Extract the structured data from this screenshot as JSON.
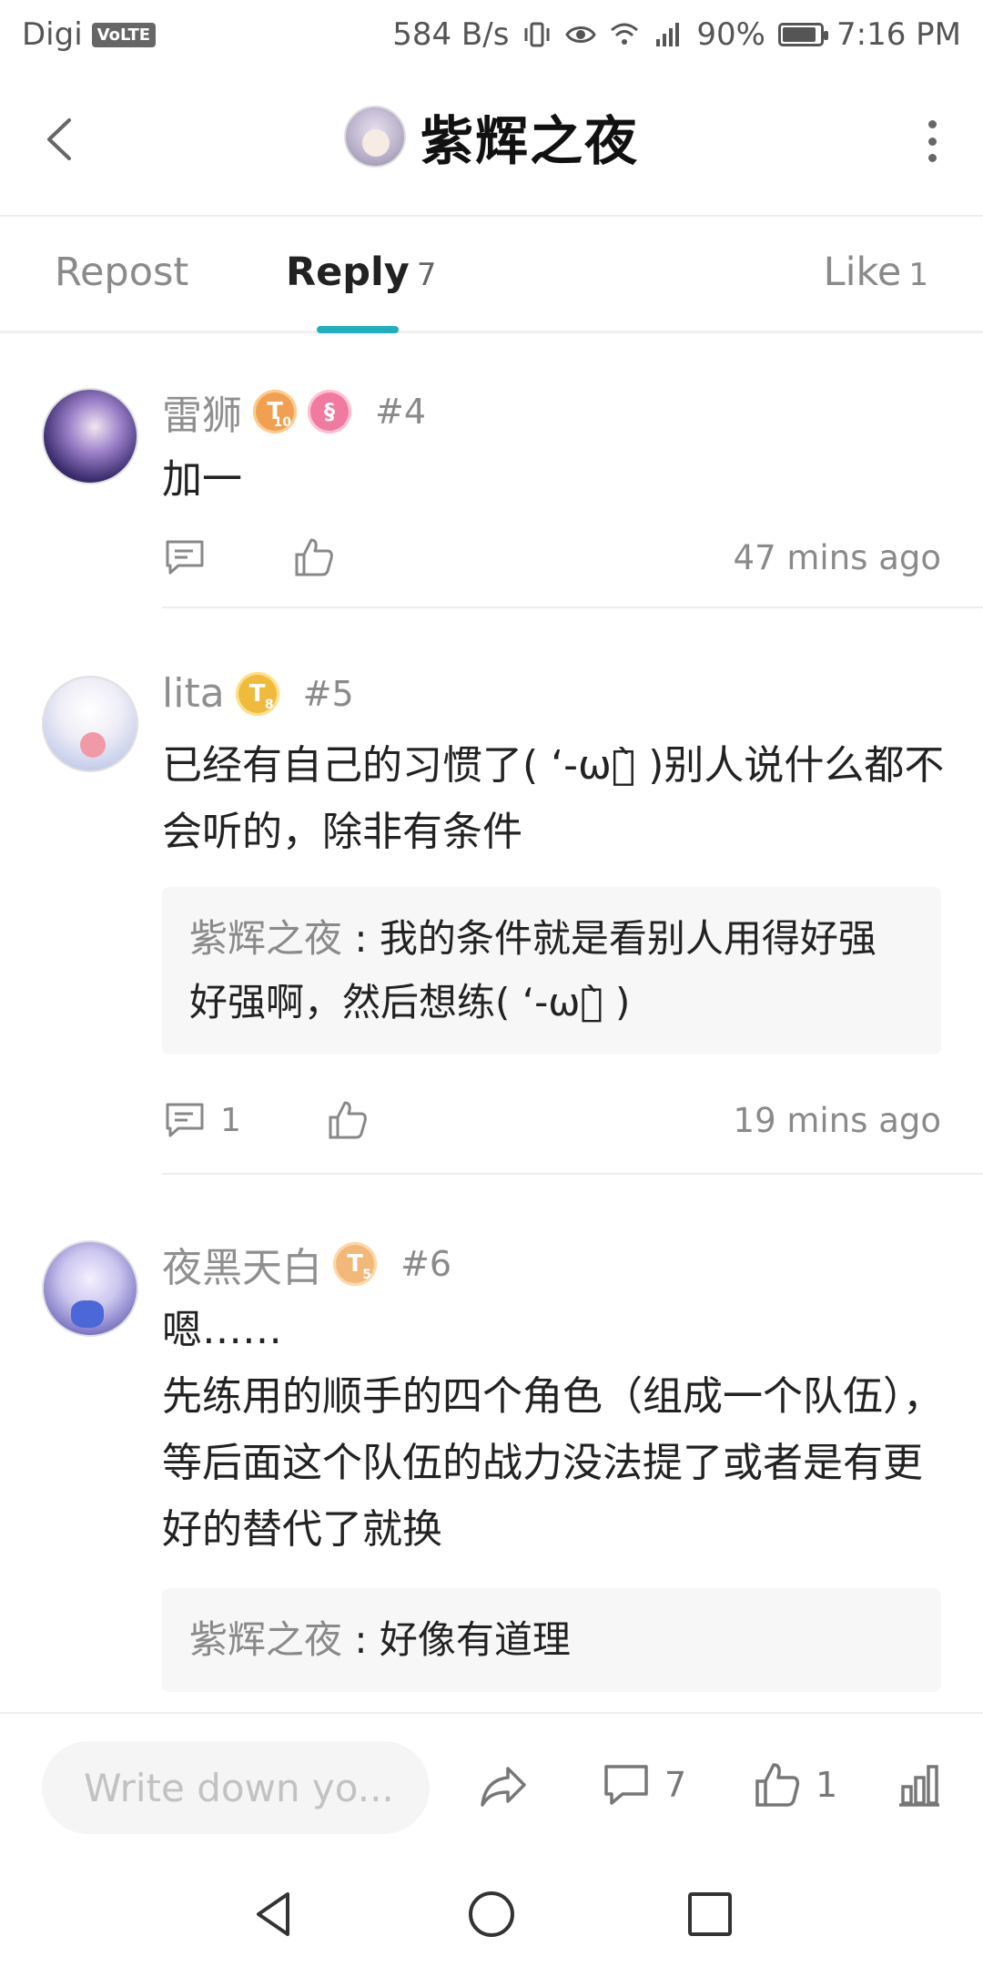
{
  "status_bar": {
    "carrier": "Digi",
    "volte": "VoLTE",
    "speed": "584 B/s",
    "battery": "90%",
    "battery_level": 0.9,
    "time": "7:16 PM"
  },
  "header": {
    "title": "紫辉之夜",
    "back_icon": "back-arrow-icon",
    "more_icon": "more-vertical-icon"
  },
  "tabs": [
    {
      "label": "Repost",
      "count": ""
    },
    {
      "label": "Reply",
      "count": "7",
      "active": true
    },
    {
      "label": "Like",
      "count": "1"
    }
  ],
  "comments": [
    {
      "username": "雷狮",
      "badges": [
        "T10",
        "S"
      ],
      "floor": "#4",
      "text": "加一",
      "reply_count": "",
      "time": "47 mins ago"
    },
    {
      "username": "lita",
      "badges": [
        "T8"
      ],
      "floor": "#5",
      "text": "已经有自己的习惯了( ‘-ωก̀ )别人说什么都不会听的，除非有条件",
      "quote": {
        "name": "紫辉之夜",
        "sep": " : ",
        "text": "我的条件就是看别人用得好强好强啊，然后想练( ‘-ωก̀ )"
      },
      "reply_count": "1",
      "time": "19 mins ago"
    },
    {
      "username": "夜黑天白",
      "badges": [
        "T5"
      ],
      "floor": "#6",
      "text_lines": [
        "嗯……",
        "先练用的顺手的四个角色（组成一个队伍），等后面这个队伍的战力没法提了或者是有更好的替代了就换"
      ],
      "quote": {
        "name": "紫辉之夜",
        "sep": " : ",
        "text": "好像有道理"
      }
    }
  ],
  "bottom_bar": {
    "input_placeholder": "Write down yo...",
    "comment_count": "7",
    "like_count": "1"
  }
}
